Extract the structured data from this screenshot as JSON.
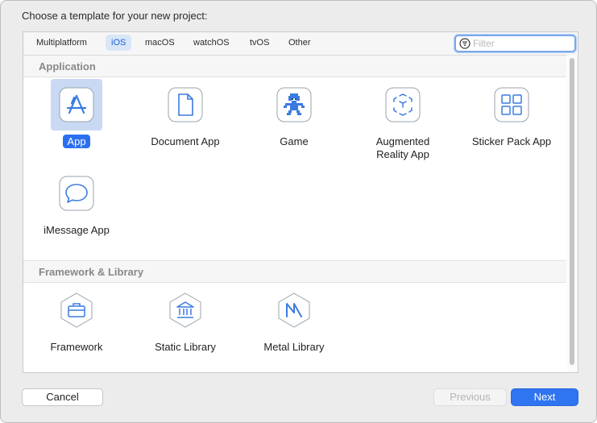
{
  "dialog": {
    "prompt": "Choose a template for your new project:"
  },
  "platform_tabs": [
    {
      "label": "Multiplatform",
      "selected": false
    },
    {
      "label": "iOS",
      "selected": true
    },
    {
      "label": "macOS",
      "selected": false
    },
    {
      "label": "watchOS",
      "selected": false
    },
    {
      "label": "tvOS",
      "selected": false
    },
    {
      "label": "Other",
      "selected": false
    }
  ],
  "filter": {
    "placeholder": "Filter",
    "value": ""
  },
  "sections": [
    {
      "title": "Application",
      "templates": [
        {
          "label": "App",
          "icon": "app-store-a-icon",
          "selected": true
        },
        {
          "label": "Document App",
          "icon": "document-icon",
          "selected": false
        },
        {
          "label": "Game",
          "icon": "game-sprite-icon",
          "selected": false
        },
        {
          "label": "Augmented\nReality App",
          "icon": "ar-cube-icon",
          "selected": false
        },
        {
          "label": "Sticker Pack App",
          "icon": "grid-icon",
          "selected": false
        },
        {
          "label": "iMessage App",
          "icon": "speech-bubble-icon",
          "selected": false
        }
      ]
    },
    {
      "title": "Framework & Library",
      "templates": [
        {
          "label": "Framework",
          "icon": "toolbox-icon",
          "selected": false
        },
        {
          "label": "Static Library",
          "icon": "bank-building-icon",
          "selected": false
        },
        {
          "label": "Metal Library",
          "icon": "metal-m-icon",
          "selected": false
        }
      ]
    }
  ],
  "buttons": {
    "cancel": "Cancel",
    "previous": "Previous",
    "next": "Next"
  },
  "colors": {
    "accent": "#2f74f0",
    "selection_bg": "#c9d9f4",
    "icon_blue": "#3a7be0"
  }
}
